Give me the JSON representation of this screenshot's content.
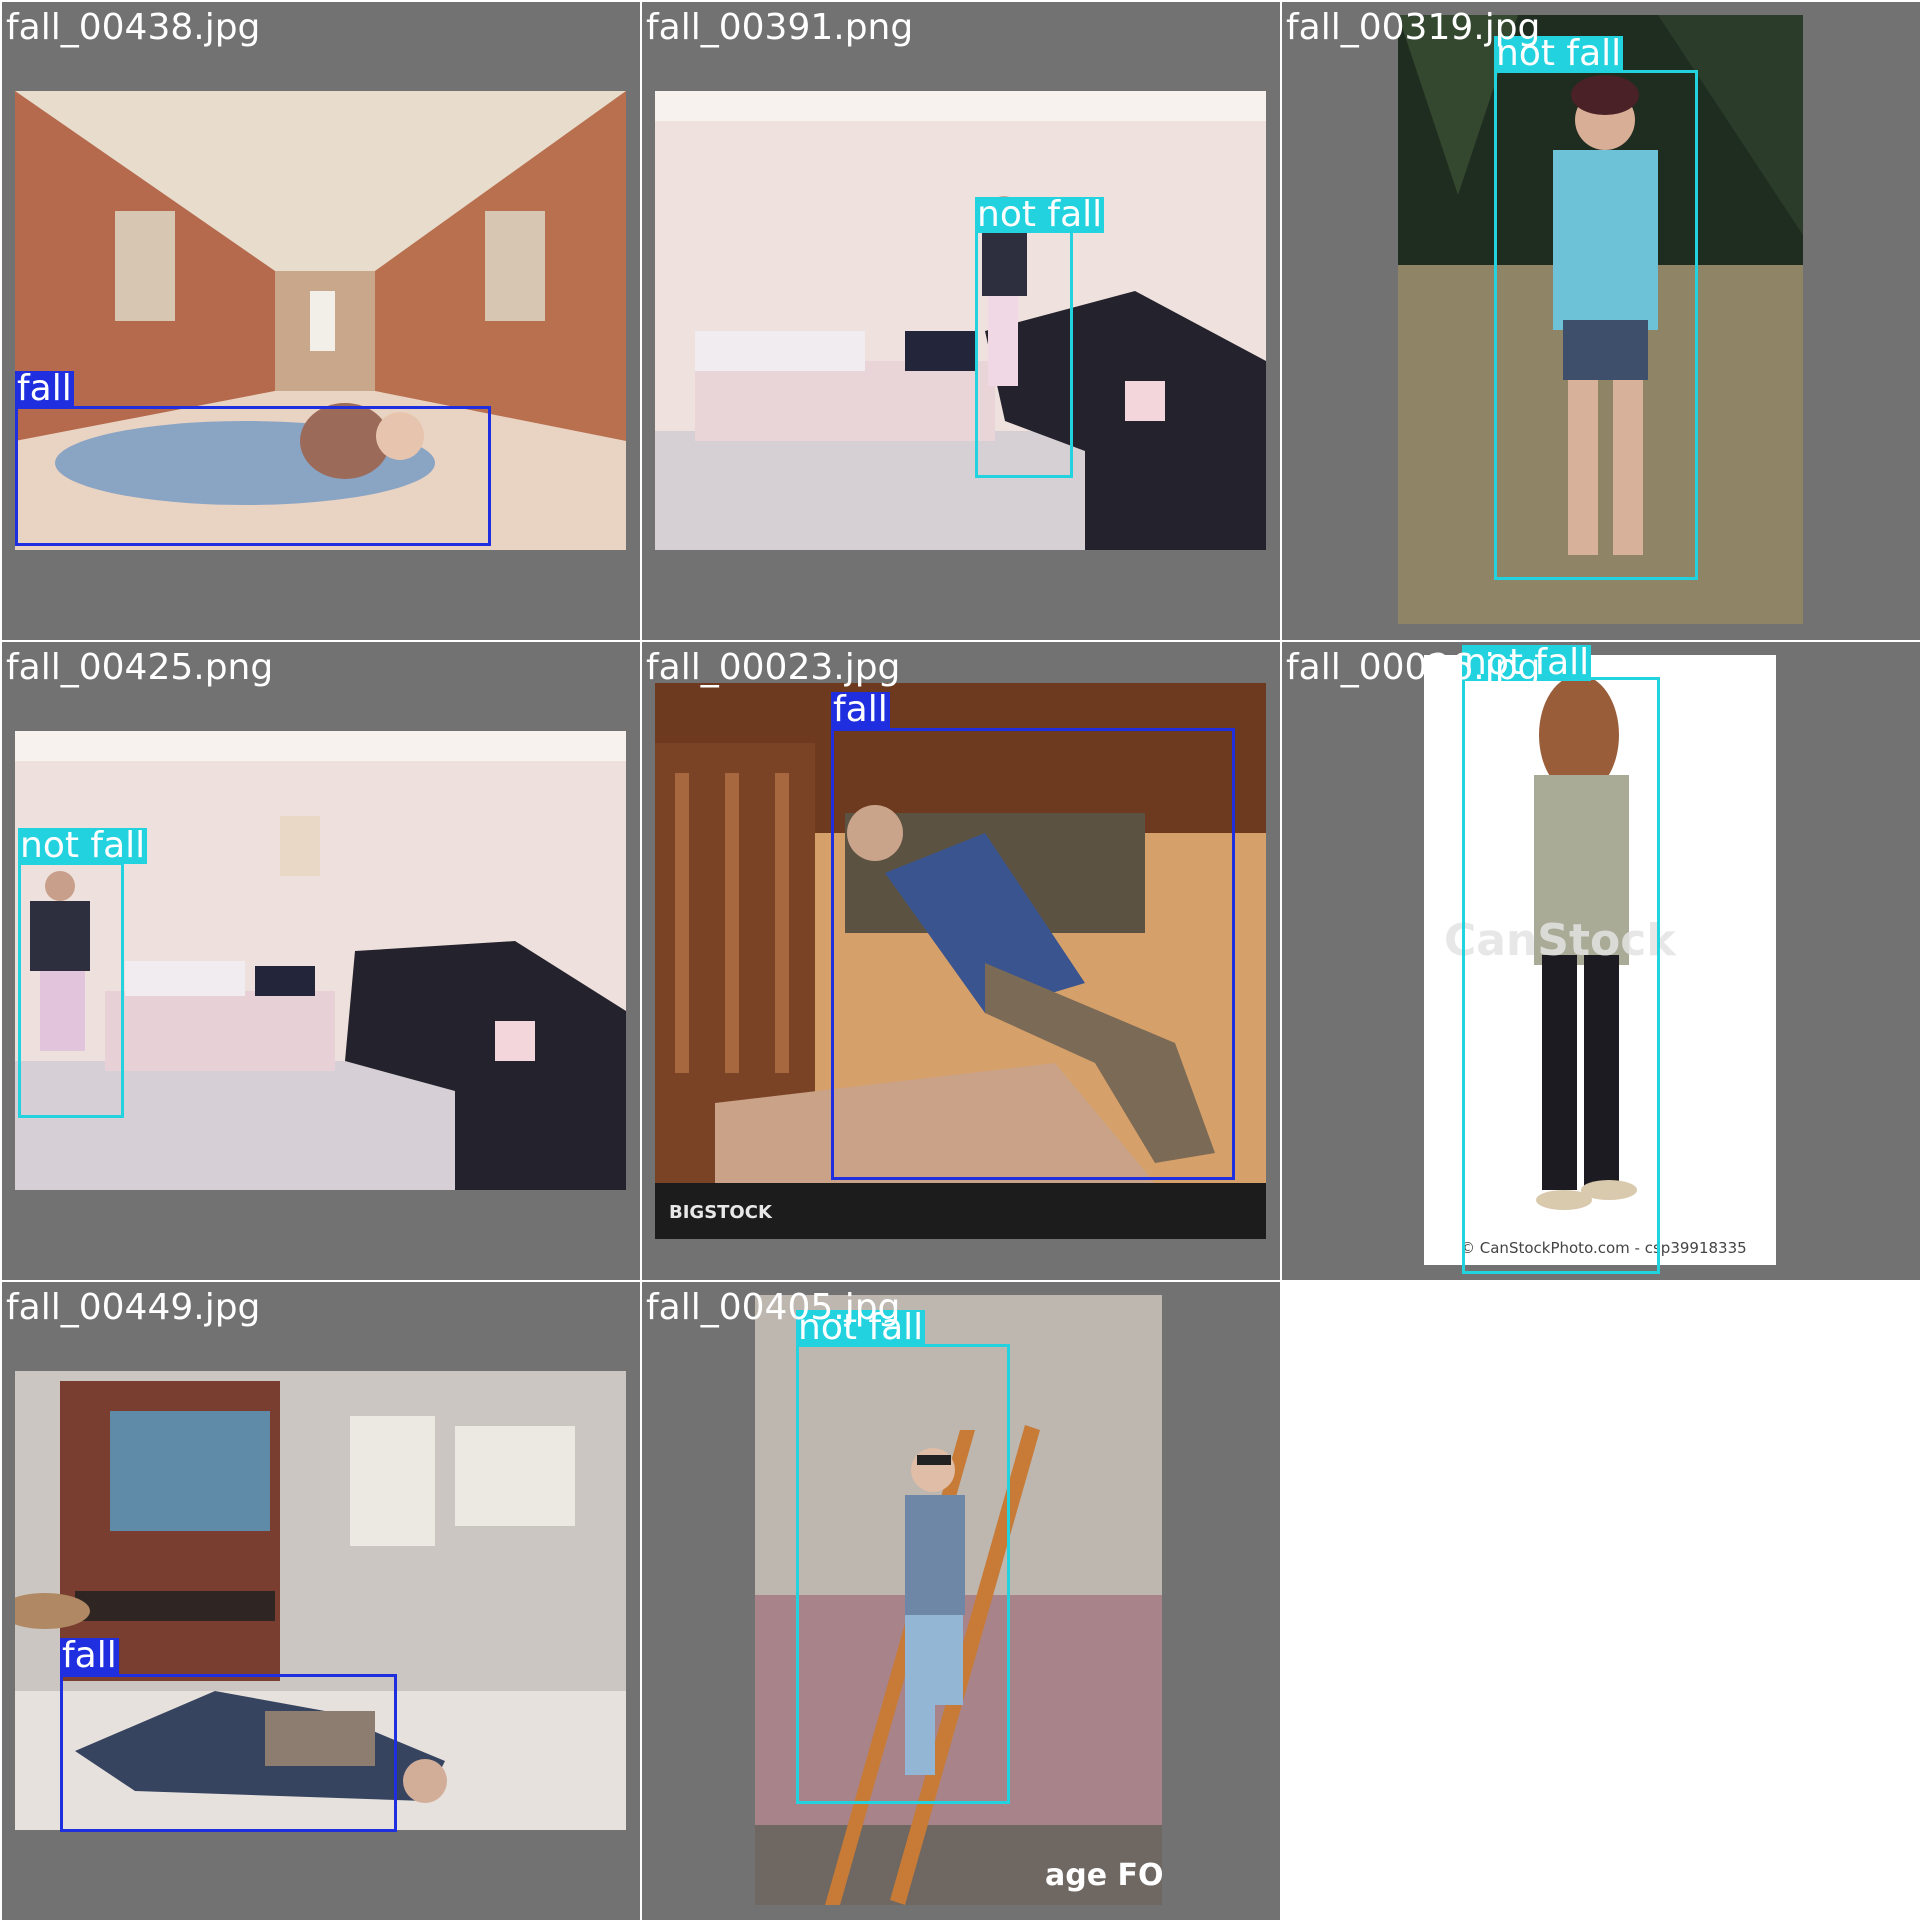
{
  "colors": {
    "fall": "#1f2fe0",
    "not_fall": "#22d3df",
    "tile_bg": "#727272"
  },
  "tiles": [
    {
      "filename": "fall_00438.jpg",
      "labels": [
        "fall"
      ]
    },
    {
      "filename": "fall_00391.png",
      "labels": [
        "not fall"
      ]
    },
    {
      "filename": "fall_00319.jpg",
      "labels": [
        "not fall"
      ]
    },
    {
      "filename": "fall_00425.png",
      "labels": [
        "not fall"
      ]
    },
    {
      "filename": "fall_00023.jpg",
      "labels": [
        "fall"
      ],
      "watermark": "BIGSTOCK"
    },
    {
      "filename": "fall_00026.jpg",
      "labels": [
        "not fall"
      ],
      "watermark": "© CanStockPhoto.com - csp39918335"
    },
    {
      "filename": "fall_00449.jpg",
      "labels": [
        "fall"
      ]
    },
    {
      "filename": "fall_00405.jpg",
      "labels": [
        "not fall"
      ],
      "watermark": "age FOTOSTOCK"
    }
  ]
}
